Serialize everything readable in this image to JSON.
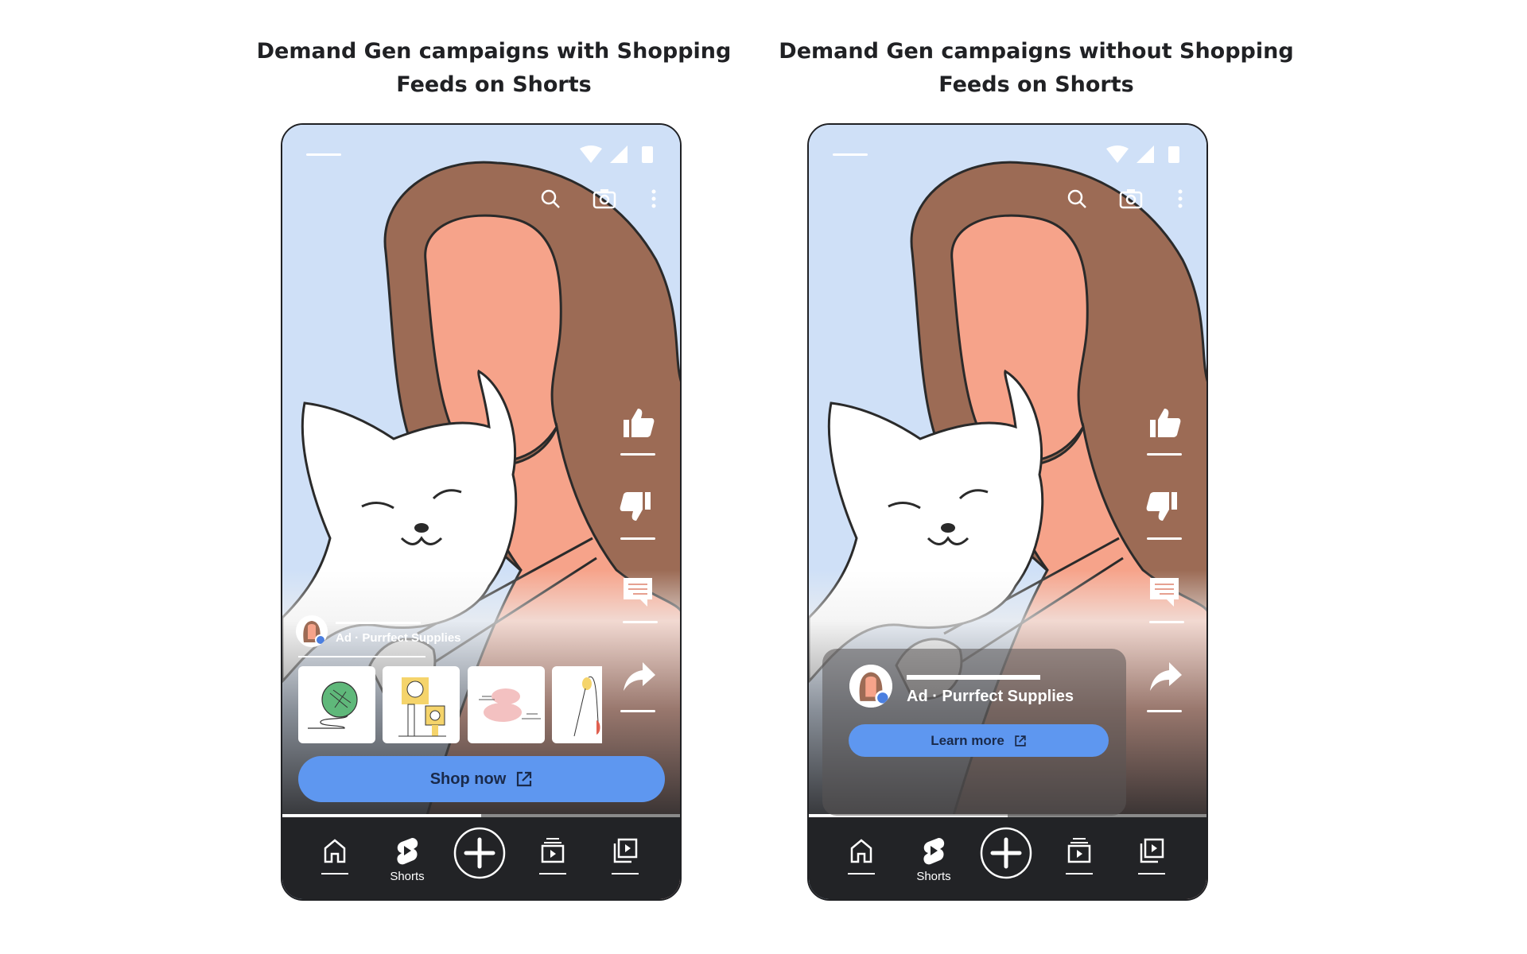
{
  "titles": {
    "left": "Demand Gen campaigns with Shopping Feeds on Shorts",
    "right": "Demand Gen campaigns without Shopping Feeds on Shorts"
  },
  "ad": {
    "advertiser_line": "Ad · Purrfect Supplies"
  },
  "left_phone": {
    "cta_label": "Shop now",
    "products": [
      "yarn-ball",
      "cat-tree",
      "toy-mice",
      "wand-toy"
    ],
    "progress": 0.5
  },
  "right_phone": {
    "cta_label": "Learn more",
    "progress": 0.5
  },
  "nav": {
    "items": [
      {
        "icon": "home-icon",
        "label": ""
      },
      {
        "icon": "shorts-icon",
        "label": "Shorts"
      },
      {
        "icon": "create-plus-icon",
        "label": ""
      },
      {
        "icon": "subscriptions-icon",
        "label": ""
      },
      {
        "icon": "library-icon",
        "label": ""
      }
    ]
  },
  "colors": {
    "sky": "#cfe0f7",
    "hair": "#9c6b55",
    "skin": "#f6a38a",
    "button": "#5e97f0",
    "navbar": "#222326"
  }
}
